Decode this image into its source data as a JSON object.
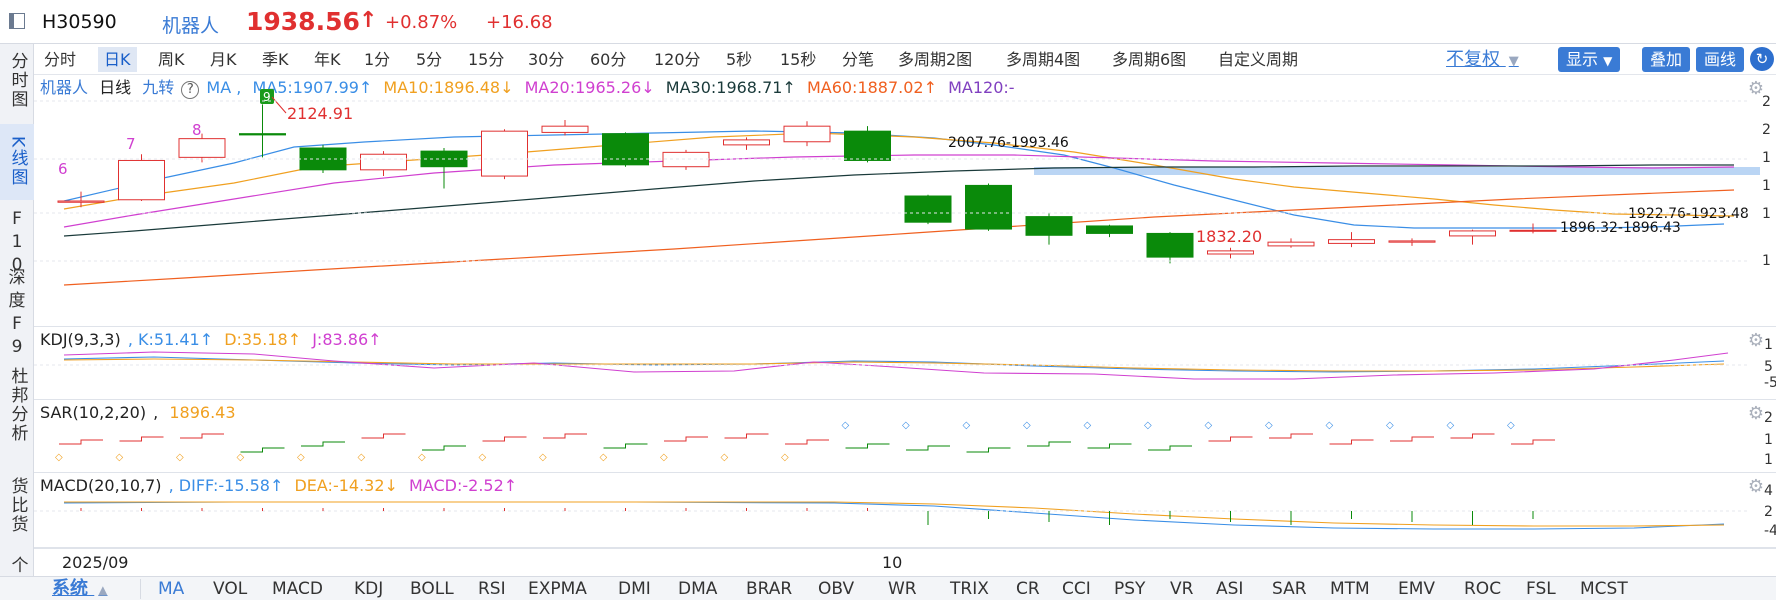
{
  "title": {
    "code": "H30590",
    "name": "机器人",
    "price": "1938.56",
    "arrow": "↑",
    "pct": "+0.87%",
    "change": "+16.68"
  },
  "side_nav": [
    "分时图",
    "K线图",
    "F10",
    "深度F9",
    "杜邦分析",
    "货比货",
    "个股"
  ],
  "period_tabs": [
    "分时",
    "日K",
    "周K",
    "月K",
    "季K",
    "年K",
    "1分",
    "5分",
    "15分",
    "30分",
    "60分",
    "120分",
    "5秒",
    "15秒",
    "分笔",
    "多周期2图",
    "多周期4图",
    "多周期6图",
    "自定义周期"
  ],
  "active_tab": "日K",
  "right_buttons": {
    "adjust": "不复权",
    "display": "显示",
    "overlay": "叠加",
    "draw": "画线"
  },
  "main_header": {
    "name": "机器人",
    "period": "日线",
    "nine": "九转",
    "help": "?",
    "ma": "MA ,",
    "ma5": "MA5:1907.99↑",
    "ma10": "MA10:1896.48↓",
    "ma20": "MA20:1965.26↓",
    "ma30": "MA30:1968.71↑",
    "ma60": "MA60:1887.02↑",
    "ma120": "MA120:-"
  },
  "annotations": {
    "n6": "6",
    "n7": "7",
    "n8": "8",
    "n9": "9",
    "high": "2124.91",
    "gap1": "2007.76-1993.46",
    "low": "1832.20",
    "gap2": "1922.76-1923.48",
    "gap3": "1896.32-1896.43"
  },
  "kdj_header": {
    "label": "KDJ(9,3,3)",
    "k": ", K:51.41↑",
    "d": "D:35.18↑",
    "j": "J:83.86↑"
  },
  "sar_header": {
    "label": "SAR(10,2,20)",
    "value": "1896.43"
  },
  "macd_header": {
    "label": "MACD(20,10,7)",
    "diff": ", DIFF:-15.58↑",
    "dea": "DEA:-14.32↓",
    "macd": "MACD:-2.52↑"
  },
  "dates": {
    "d1": "2025/09",
    "d2": "10"
  },
  "indicator_tabs": [
    "系统",
    "MA",
    "VOL",
    "MACD",
    "KDJ",
    "BOLL",
    "RSI",
    "EXPMA",
    "DMI",
    "DMA",
    "BRAR",
    "OBV",
    "WR",
    "TRIX",
    "CR",
    "CCI",
    "PSY",
    "VR",
    "ASI",
    "SAR",
    "MTM",
    "EMV",
    "ROC",
    "FSL",
    "MCST"
  ],
  "axis_ticks": {
    "main": [
      "2",
      "2",
      "1",
      "1",
      "1",
      "1"
    ],
    "kdj": [
      "1",
      "5",
      "-5"
    ],
    "sar": [
      "2",
      "1",
      "1"
    ],
    "macd": [
      "4",
      "2",
      "-4"
    ]
  },
  "colors": {
    "up": "#e03030",
    "down": "#0a8a0a",
    "ma5": "#3a8ee6",
    "ma10": "#f0a020",
    "ma20": "#d040d0",
    "ma30": "#1a3a3a",
    "ma60": "#f06020",
    "ma120": "#8040c0"
  },
  "candles": [
    {
      "o": 1968,
      "c": 1970,
      "h": 1985,
      "l": 1960
    },
    {
      "o": 1972,
      "c": 2035,
      "h": 2045,
      "l": 1970
    },
    {
      "o": 2040,
      "c": 2070,
      "h": 2078,
      "l": 2032
    },
    {
      "o": 2078,
      "c": 2076,
      "h": 2125,
      "l": 2040
    },
    {
      "o": 2055,
      "c": 2020,
      "h": 2060,
      "l": 2015
    },
    {
      "o": 2020,
      "c": 2045,
      "h": 2050,
      "l": 2010
    },
    {
      "o": 2050,
      "c": 2025,
      "h": 2055,
      "l": 1990
    },
    {
      "o": 2010,
      "c": 2082,
      "h": 2085,
      "l": 2005
    },
    {
      "o": 2080,
      "c": 2090,
      "h": 2100,
      "l": 2075
    },
    {
      "o": 2078,
      "c": 2028,
      "h": 2080,
      "l": 2025
    },
    {
      "o": 2025,
      "c": 2048,
      "h": 2052,
      "l": 2020
    },
    {
      "o": 2060,
      "c": 2068,
      "h": 2072,
      "l": 2052
    },
    {
      "o": 2065,
      "c": 2090,
      "h": 2098,
      "l": 2058
    },
    {
      "o": 2082,
      "c": 2035,
      "h": 2090,
      "l": 2032
    },
    {
      "o": 1978,
      "c": 1936,
      "h": 1980,
      "l": 1933
    },
    {
      "o": 1995,
      "c": 1925,
      "h": 1998,
      "l": 1922
    },
    {
      "o": 1945,
      "c": 1915,
      "h": 1950,
      "l": 1900
    },
    {
      "o": 1930,
      "c": 1918,
      "h": 1932,
      "l": 1912
    },
    {
      "o": 1918,
      "c": 1880,
      "h": 1920,
      "l": 1870
    },
    {
      "o": 1885,
      "c": 1890,
      "h": 1895,
      "l": 1878
    },
    {
      "o": 1898,
      "c": 1904,
      "h": 1910,
      "l": 1895
    },
    {
      "o": 1902,
      "c": 1908,
      "h": 1920,
      "l": 1896
    },
    {
      "o": 1904,
      "c": 1906,
      "h": 1910,
      "l": 1898
    },
    {
      "o": 1914,
      "c": 1922,
      "h": 1924,
      "l": 1900
    },
    {
      "o": 1922,
      "c": 1923,
      "h": 1934,
      "l": 1918
    }
  ]
}
